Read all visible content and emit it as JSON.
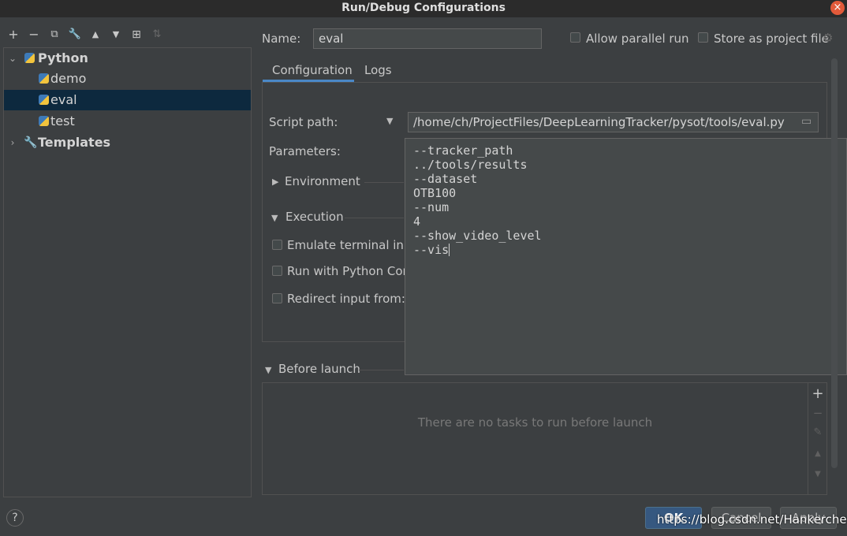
{
  "window": {
    "title": "Run/Debug Configurations"
  },
  "toolbar": {
    "add": "+",
    "remove": "−",
    "copy": "⧉",
    "edit": "🔧",
    "up": "▲",
    "down": "▼",
    "folder": "⊞",
    "sort": "⇅"
  },
  "tree": {
    "python": "Python",
    "items": [
      "demo",
      "eval",
      "test"
    ],
    "templates": "Templates"
  },
  "form": {
    "name_label": "Name:",
    "name_value": "eval",
    "allow_parallel": "Allow parallel run",
    "store_project": "Store as project file",
    "tabs": [
      "Configuration",
      "Logs"
    ],
    "script_path_label": "Script path:",
    "script_path_value": "/home/ch/ProjectFiles/DeepLearningTracker/pysot/tools/eval.py",
    "parameters_label": "Parameters:",
    "environment": "Environment",
    "execution": "Execution",
    "emulate": "Emulate terminal in o",
    "python_console": "Run with Python Cons",
    "redirect": "Redirect input from:",
    "parameters_text": "--tracker_path\n../tools/results\n--dataset\nOTB100\n--num\n4\n--show_video_level\n--vis"
  },
  "before_launch": {
    "title": "Before launch",
    "empty": "There are no tasks to run before launch"
  },
  "buttons": {
    "help": "?",
    "ok": "OK",
    "cancel": "Cancel",
    "apply": "Apply"
  },
  "watermark": "https://blog.csdn.net/Hankerchen"
}
